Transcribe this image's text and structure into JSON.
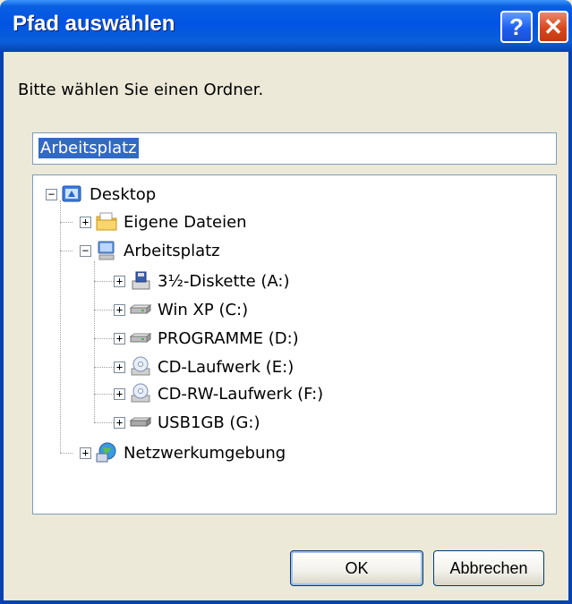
{
  "window": {
    "title": "Pfad auswählen",
    "help_label": "?",
    "close_label": "✕"
  },
  "prompt": "Bitte wählen Sie einen Ordner.",
  "path_input": {
    "value": "Arbeitsplatz"
  },
  "tree": {
    "desktop": {
      "label": "Desktop",
      "expander": "−"
    },
    "eigene_dateien": {
      "label": "Eigene Dateien",
      "expander": "+"
    },
    "arbeitsplatz": {
      "label": "Arbeitsplatz",
      "expander": "−"
    },
    "diskette": {
      "label": "3½-Diskette (A:)",
      "expander": "+"
    },
    "win_xp": {
      "label": "Win XP (C:)",
      "expander": "+"
    },
    "programme": {
      "label": "PROGRAMME (D:)",
      "expander": "+"
    },
    "cd": {
      "label": "CD-Laufwerk (E:)",
      "expander": "+"
    },
    "cdrw": {
      "label": "CD-RW-Laufwerk (F:)",
      "expander": "+"
    },
    "usb": {
      "label": "USB1GB (G:)",
      "expander": "+"
    },
    "netzwerk": {
      "label": "Netzwerkumgebung",
      "expander": "+"
    }
  },
  "buttons": {
    "ok": "OK",
    "cancel": "Abbrechen"
  },
  "colors": {
    "titlebar": "#0054e3",
    "selection": "#316ac5",
    "face": "#ece9d8"
  }
}
